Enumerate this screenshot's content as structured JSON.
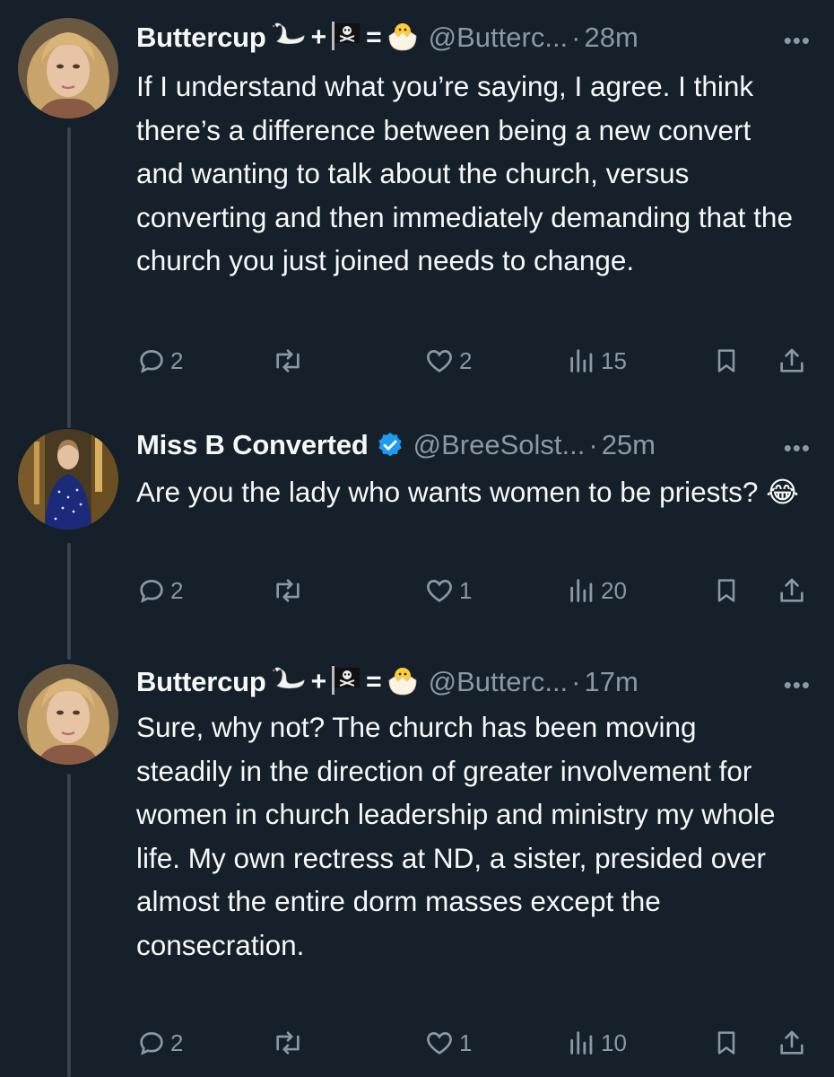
{
  "tweets": [
    {
      "name": "Buttercup",
      "handle": "@Butterc...",
      "time": "28m",
      "more": "•••",
      "text": "If I understand what you’re saying, I agree. I think there’s a difference between being a new convert and wanting to talk about the church, versus converting and then immediately demanding that the church you just joined needs to change.",
      "stats": {
        "replies": "2",
        "retweets": "",
        "likes": "2",
        "views": "15"
      }
    },
    {
      "name": "Miss B Converted",
      "handle": "@BreeSolst...",
      "time": "25m",
      "more": "•••",
      "verified": true,
      "text": "Are you the lady who wants women to be priests?",
      "stats": {
        "replies": "2",
        "retweets": "",
        "likes": "1",
        "views": "20"
      }
    },
    {
      "name": "Buttercup",
      "handle": "@Butterc...",
      "time": "17m",
      "more": "•••",
      "text": "Sure, why not? The church has been moving steadily in the direction of greater involvement for women in church leadership and ministry my whole life. My own rectress at ND, a sister, presided over almost the entire dorm masses except the consecration.",
      "stats": {
        "replies": "2",
        "retweets": "",
        "likes": "1",
        "views": "10"
      }
    }
  ],
  "symbols": {
    "plus": "+",
    "equals": "=",
    "dot": "·",
    "laugh_emoji": "😂"
  },
  "colors": {
    "background": "#15202b",
    "text": "#f7f9f9",
    "muted": "#8b98a5",
    "verified": "#1d9bf0",
    "thread_line": "#38444d"
  },
  "icons": [
    "swan-icon",
    "pirate-flag-icon",
    "hatching-chick-icon",
    "reply-icon",
    "retweet-icon",
    "like-icon",
    "views-icon",
    "bookmark-icon",
    "share-icon",
    "verified-badge-icon"
  ]
}
